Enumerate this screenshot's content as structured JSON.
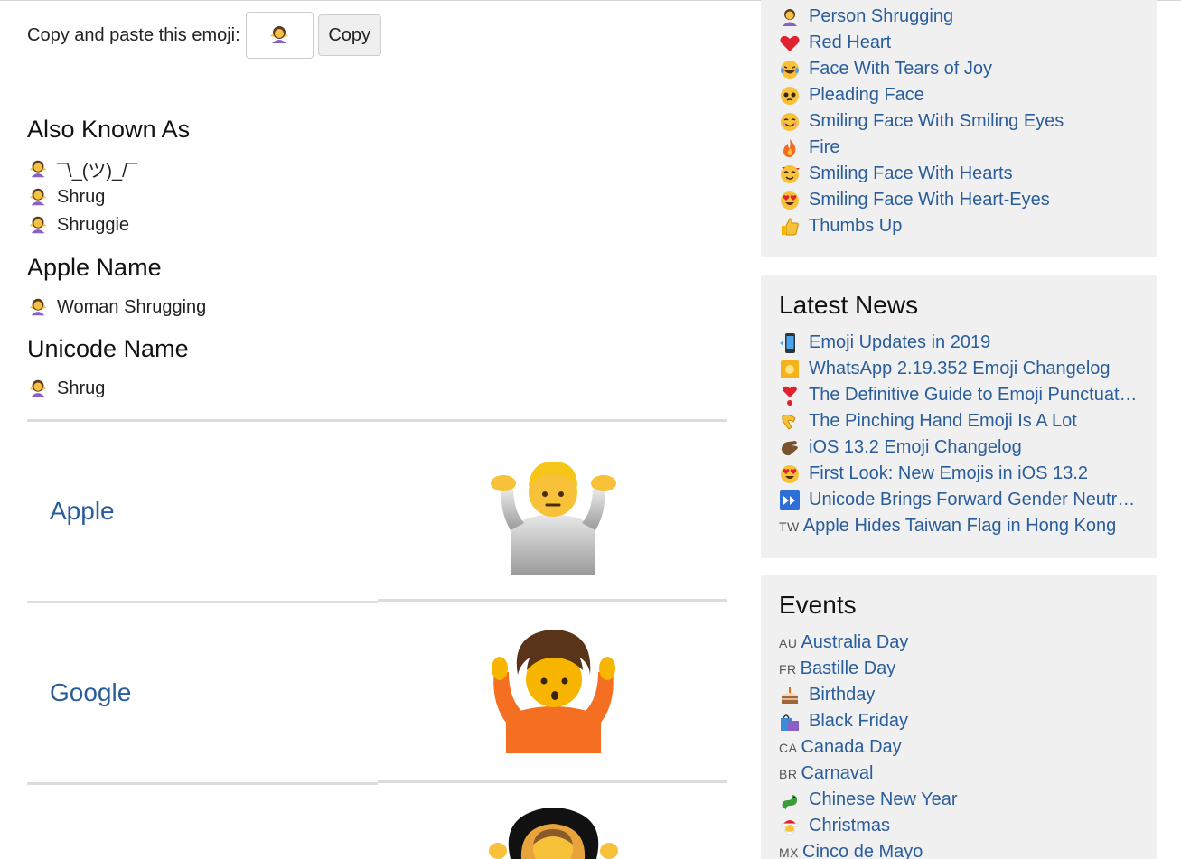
{
  "copy": {
    "label": "Copy and paste this emoji:",
    "button": "Copy"
  },
  "also_known_as": {
    "heading": "Also Known As",
    "items": [
      "¯\\_(ツ)_/¯",
      "Shrug",
      "Shruggie"
    ]
  },
  "apple_name": {
    "heading": "Apple Name",
    "value": "Woman Shrugging"
  },
  "unicode_name": {
    "heading": "Unicode Name",
    "value": "Shrug"
  },
  "vendors": [
    {
      "name": "Apple"
    },
    {
      "name": "Google"
    }
  ],
  "trending": [
    {
      "label": "Person Shrugging",
      "icon": "person-shrugging-icon"
    },
    {
      "label": "Red Heart",
      "icon": "red-heart-icon"
    },
    {
      "label": "Face With Tears of Joy",
      "icon": "tears-of-joy-icon"
    },
    {
      "label": "Pleading Face",
      "icon": "pleading-face-icon"
    },
    {
      "label": "Smiling Face With Smiling Eyes",
      "icon": "smiling-eyes-icon"
    },
    {
      "label": "Fire",
      "icon": "fire-icon"
    },
    {
      "label": "Smiling Face With Hearts",
      "icon": "smiling-hearts-icon"
    },
    {
      "label": "Smiling Face With Heart-Eyes",
      "icon": "heart-eyes-icon"
    },
    {
      "label": "Thumbs Up",
      "icon": "thumbs-up-icon"
    }
  ],
  "latest_news": {
    "heading": "Latest News",
    "items": [
      {
        "label": "Emoji Updates in 2019",
        "icon": "mobile-phone-icon"
      },
      {
        "label": "WhatsApp 2.19.352 Emoji Changelog",
        "icon": "whatsapp-icon"
      },
      {
        "label": "The Definitive Guide to Emoji Punctuation",
        "icon": "exclamation-heart-icon"
      },
      {
        "label": "The Pinching Hand Emoji Is A Lot",
        "icon": "pinching-hand-icon"
      },
      {
        "label": "iOS 13.2 Emoji Changelog",
        "icon": "hand-icon"
      },
      {
        "label": "First Look: New Emojis in iOS 13.2",
        "icon": "heart-eyes-icon"
      },
      {
        "label": "Unicode Brings Forward Gender Neutr…",
        "icon": "fast-forward-icon"
      },
      {
        "label": "Apple Hides Taiwan Flag in Hong Kong",
        "flag": "TW"
      }
    ]
  },
  "events": {
    "heading": "Events",
    "items": [
      {
        "label": "Australia Day",
        "flag": "AU"
      },
      {
        "label": "Bastille Day",
        "flag": "FR"
      },
      {
        "label": "Birthday",
        "icon": "birthday-cake-icon"
      },
      {
        "label": "Black Friday",
        "icon": "shopping-bags-icon"
      },
      {
        "label": "Canada Day",
        "flag": "CA"
      },
      {
        "label": "Carnaval",
        "flag": "BR"
      },
      {
        "label": "Chinese New Year",
        "icon": "dragon-icon"
      },
      {
        "label": "Christmas",
        "icon": "santa-icon"
      },
      {
        "label": "Cinco de Mayo",
        "flag": "MX"
      }
    ]
  },
  "colors": {
    "link": "#2a5d9c",
    "sidebar_bg": "#f0f0f0",
    "divider": "#dcdcdc"
  }
}
